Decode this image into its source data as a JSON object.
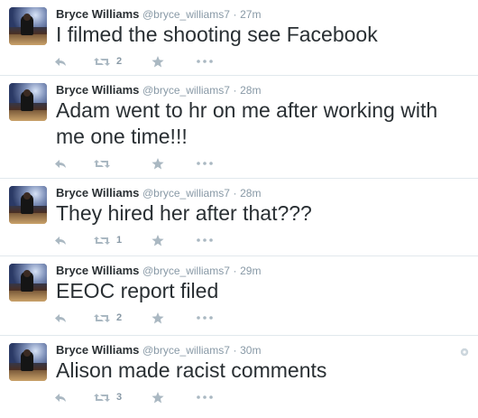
{
  "tweets": [
    {
      "name": "Bryce Williams",
      "handle": "@bryce_williams7",
      "sep": "·",
      "time": "27m",
      "text": "I filmed the shooting see Facebook",
      "retweets": "2",
      "show_gear": false
    },
    {
      "name": "Bryce Williams",
      "handle": "@bryce_williams7",
      "sep": "·",
      "time": "28m",
      "text": "Adam went to hr on me after working with me one time!!!",
      "retweets": "",
      "show_gear": false
    },
    {
      "name": "Bryce Williams",
      "handle": "@bryce_williams7",
      "sep": "·",
      "time": "28m",
      "text": "They hired her after that???",
      "retweets": "1",
      "show_gear": false
    },
    {
      "name": "Bryce Williams",
      "handle": "@bryce_williams7",
      "sep": "·",
      "time": "29m",
      "text": "EEOC report filed",
      "retweets": "2",
      "show_gear": false
    },
    {
      "name": "Bryce Williams",
      "handle": "@bryce_williams7",
      "sep": "·",
      "time": "30m",
      "text": "Alison made racist comments",
      "retweets": "3",
      "show_gear": true
    }
  ],
  "icons": {
    "reply": "reply-icon",
    "retweet": "retweet-icon",
    "favorite": "star-icon",
    "more": "more-dots-icon",
    "settings": "gear-icon"
  },
  "colors": {
    "text": "#292f33",
    "muted": "#8899a6",
    "icon": "#aab8c2",
    "divider": "#e1e8ed"
  }
}
